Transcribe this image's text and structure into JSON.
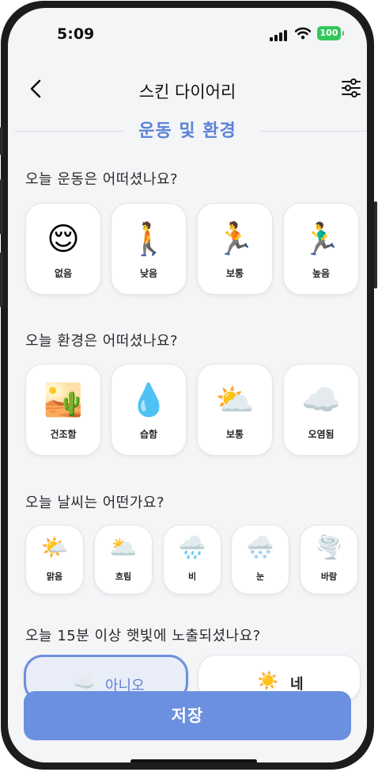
{
  "status": {
    "time": "5:09",
    "battery": "100"
  },
  "nav": {
    "title": "스킨 다이어리",
    "back_icon": "chevron-left-icon",
    "filter_icon": "sliders-icon"
  },
  "section": {
    "title": "운동 및 환경"
  },
  "exercise": {
    "question": "오늘 운동은 어떠셨나요?",
    "options": [
      {
        "label": "없음",
        "icon": "😌"
      },
      {
        "label": "낮음",
        "icon": "🚶"
      },
      {
        "label": "보통",
        "icon": "🏃"
      },
      {
        "label": "높음",
        "icon": "🏃‍♂️"
      }
    ]
  },
  "environment": {
    "question": "오늘 환경은 어떠셨나요?",
    "options": [
      {
        "label": "건조함",
        "icon": "🏜️"
      },
      {
        "label": "습함",
        "icon": "💧"
      },
      {
        "label": "보통",
        "icon": "⛅"
      },
      {
        "label": "오염됨",
        "icon": "☁️"
      }
    ]
  },
  "weather": {
    "question": "오늘 날씨는 어떤가요?",
    "options": [
      {
        "label": "맑음",
        "icon": "🌤️"
      },
      {
        "label": "흐림",
        "icon": "🌥️"
      },
      {
        "label": "비",
        "icon": "🌧️"
      },
      {
        "label": "눈",
        "icon": "🌨️"
      },
      {
        "label": "바람",
        "icon": "🌪️"
      }
    ]
  },
  "sunlight": {
    "question": "오늘 15분 이상 햇빛에 노출되셨나요?",
    "options": [
      {
        "label": "아니오",
        "icon": "☁️",
        "selected": true
      },
      {
        "label": "네",
        "icon": "☀️",
        "selected": false
      }
    ]
  },
  "save_label": "저장",
  "colors": {
    "accent": "#5b82d9",
    "button": "#6b90e0",
    "selected_border": "#6e8fdf"
  }
}
